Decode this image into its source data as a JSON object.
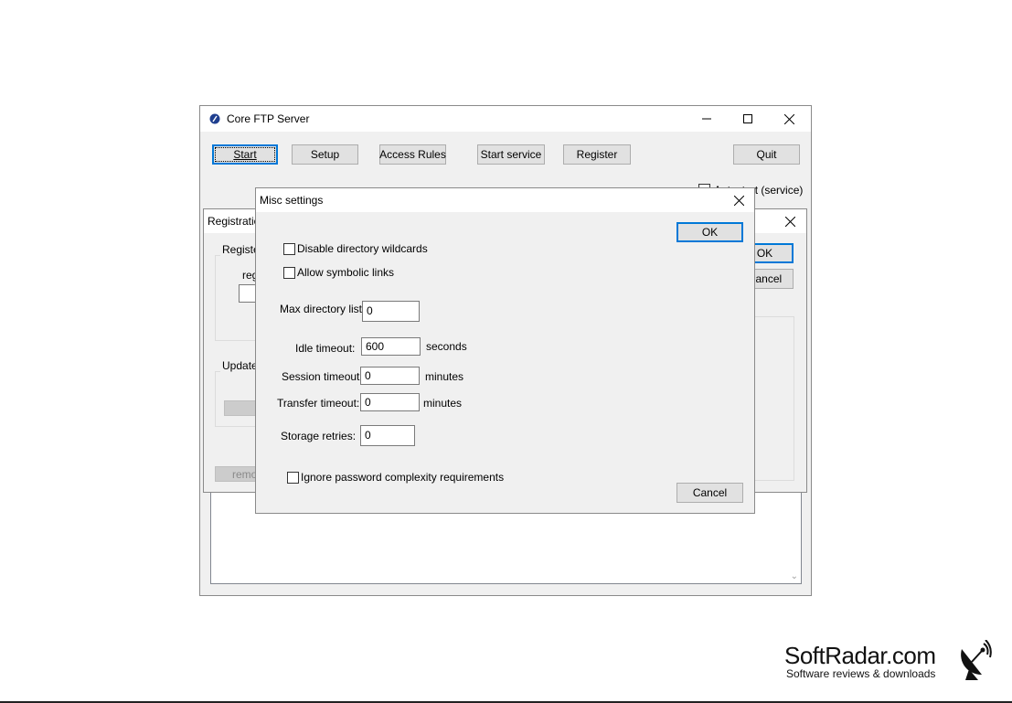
{
  "main_window": {
    "title": "Core FTP Server",
    "buttons": {
      "start": "Start",
      "setup": "Setup",
      "access_rules": "Access Rules",
      "start_service": "Start service",
      "register": "Register",
      "quit": "Quit"
    },
    "autostart_label": "Autostart (service)"
  },
  "registration_window": {
    "title": "Registration",
    "group_register": "Register",
    "reg_label": "reg",
    "group_update": "Update",
    "ok": "OK",
    "cancel": "Cancel",
    "remove": "remove"
  },
  "misc_dialog": {
    "title": "Misc settings",
    "ok": "OK",
    "cancel": "Cancel",
    "disable_wildcards": "Disable directory wildcards",
    "allow_symlinks": "Allow symbolic links",
    "max_dir_list_label": "Max directory list",
    "max_dir_list_value": "0",
    "idle_timeout_label": "Idle timeout:",
    "idle_timeout_value": "600",
    "idle_timeout_unit": "seconds",
    "session_timeout_label": "Session timeout:",
    "session_timeout_value": "0",
    "session_timeout_unit": "minutes",
    "transfer_timeout_label": "Transfer timeout:",
    "transfer_timeout_value": "0",
    "transfer_timeout_unit": "minutes",
    "storage_retries_label": "Storage retries:",
    "storage_retries_value": "0",
    "ignore_password": "Ignore password complexity requirements",
    "checkbox_states": {
      "disable_wildcards": false,
      "allow_symlinks": false,
      "ignore_password": false
    }
  },
  "watermark": {
    "brand": "SoftRadar.com",
    "tagline": "Software reviews & downloads"
  },
  "colors": {
    "focus_border": "#0078d7",
    "dialog_bg": "#f0f0f0",
    "titlebar_bg": "#ffffff"
  }
}
